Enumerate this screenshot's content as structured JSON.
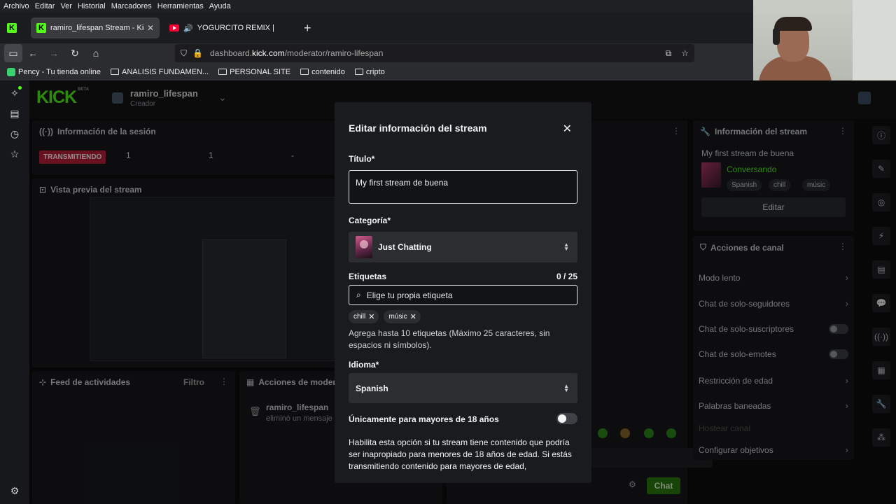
{
  "os_menu": [
    "Archivo",
    "Editar",
    "Ver",
    "Historial",
    "Marcadores",
    "Herramientas",
    "Ayuda"
  ],
  "tabs": [
    {
      "title": "ramiro_lifespan Stream - Kick D",
      "active": true
    },
    {
      "title": "YOGURCITO REMIX |",
      "active": false
    }
  ],
  "url": {
    "prefix": "dashboard.",
    "domain": "kick.com",
    "path": "/moderator/ramiro-lifespan"
  },
  "bookmarks": [
    "Pency - Tu tienda online",
    "ANALISIS FUNDAMEN...",
    "PERSONAL SITE",
    "contenido",
    "cripto"
  ],
  "channel": {
    "name": "ramiro_lifespan",
    "role": "Creador",
    "logo_badge": "BETA",
    "logo": "KICK"
  },
  "session": {
    "title": "Información de la sesión",
    "live_badge": "TRANSMITIENDO",
    "stats": [
      "1",
      "1",
      "-"
    ]
  },
  "preview": {
    "title": "Vista previa del stream"
  },
  "activity": {
    "title": "Feed de actividades",
    "filter": "Filtro"
  },
  "mod_actions": {
    "title": "Acciones de modera",
    "user": "ramiro_lifespan",
    "action": "eliminó un mensaje"
  },
  "stream_info": {
    "title": "Información del stream",
    "stream_title": "My first stream de buena",
    "category": "Conversando",
    "chips": [
      "Spanish",
      "chill",
      "músic"
    ],
    "edit_label": "Editar"
  },
  "channel_actions": {
    "title": "Acciones de canal",
    "items": [
      {
        "label": "Modo lento",
        "control": "chevron"
      },
      {
        "label": "Chat de solo-seguidores",
        "control": "chevron"
      },
      {
        "label": "Chat de solo-suscriptores",
        "control": "toggle"
      },
      {
        "label": "Chat de solo-emotes",
        "control": "toggle"
      },
      {
        "label": "Restricción de edad",
        "control": "chevron"
      },
      {
        "label": "Palabras baneadas",
        "control": "chevron"
      },
      {
        "label": "Hostear canal",
        "control": "none"
      },
      {
        "label": "Configurar objetivos",
        "control": "chevron"
      }
    ]
  },
  "chat": {
    "send_label": "Chat"
  },
  "modal": {
    "title": "Editar información del stream",
    "title_label": "Título*",
    "title_value": "My first stream de buena",
    "category_label": "Categoría*",
    "category_value": "Just Chatting",
    "tags_label": "Etiquetas",
    "tags_counter": "0 / 25",
    "tags_placeholder": "Elige tu propia etiqueta",
    "tags": [
      "chill",
      "músic"
    ],
    "tags_help": "Agrega hasta 10 etiquetas (Máximo 25 caracteres, sin espacios ni símbolos).",
    "language_label": "Idioma*",
    "language_value": "Spanish",
    "adult_label": "Únicamente para mayores de 18 años",
    "adult_enabled": false,
    "adult_help": "Habilita esta opción si tu stream tiene contenido que podría ser inapropiado para menores de 18 años de edad. Si estás transmitiendo contenido para mayores de edad,"
  },
  "colors": {
    "accent": "#53fc18",
    "live": "#c0213a",
    "modal_bg": "#1a1b1e"
  }
}
